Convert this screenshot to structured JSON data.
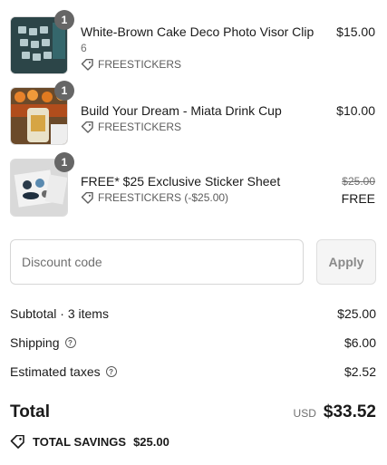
{
  "items": [
    {
      "title": "White-Brown Cake Deco Photo Visor Clip",
      "variant": "6",
      "quantity": "1",
      "discount_code": "FREESTICKERS",
      "price": "$15.00"
    },
    {
      "title": "Build Your Dream - Miata Drink Cup",
      "quantity": "1",
      "discount_code": "FREESTICKERS",
      "price": "$10.00"
    },
    {
      "title": "FREE* $25 Exclusive Sticker Sheet",
      "quantity": "1",
      "discount_code": "FREESTICKERS (-$25.00)",
      "original_price": "$25.00",
      "price": "FREE"
    }
  ],
  "discount": {
    "placeholder": "Discount code",
    "apply_label": "Apply"
  },
  "summary": {
    "subtotal_label": "Subtotal · 3 items",
    "subtotal_value": "$25.00",
    "shipping_label": "Shipping",
    "shipping_value": "$6.00",
    "taxes_label": "Estimated taxes",
    "taxes_value": "$2.52",
    "total_label": "Total",
    "currency": "USD",
    "total_value": "$33.52",
    "savings_label": "TOTAL SAVINGS",
    "savings_value": "$25.00"
  },
  "icons": {
    "discount_tag": "tag-icon",
    "help": "question-circle-icon",
    "savings": "tag-icon"
  }
}
